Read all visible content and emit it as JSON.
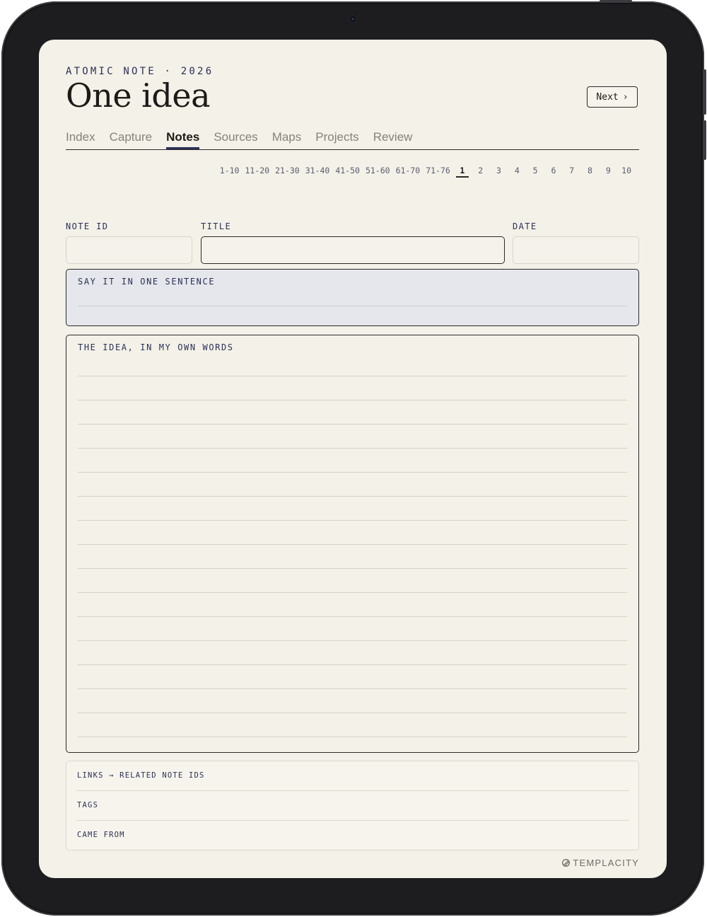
{
  "header": {
    "eyebrow": "ATOMIC NOTE · 2026",
    "title": "One idea",
    "next_label": "Next",
    "next_chevron": "›"
  },
  "tabs": [
    {
      "label": "Index",
      "active": false
    },
    {
      "label": "Capture",
      "active": false
    },
    {
      "label": "Notes",
      "active": true
    },
    {
      "label": "Sources",
      "active": false
    },
    {
      "label": "Maps",
      "active": false
    },
    {
      "label": "Projects",
      "active": false
    },
    {
      "label": "Review",
      "active": false
    }
  ],
  "pager": {
    "ranges": [
      "1-10",
      "11-20",
      "21-30",
      "31-40",
      "41-50",
      "51-60",
      "61-70",
      "71-76"
    ],
    "pages": [
      "1",
      "2",
      "3",
      "4",
      "5",
      "6",
      "7",
      "8",
      "9",
      "10"
    ],
    "active_page": "1"
  },
  "fields": {
    "note_id": {
      "label": "NOTE ID",
      "value": ""
    },
    "title": {
      "label": "TITLE",
      "value": ""
    },
    "date": {
      "label": "DATE",
      "value": ""
    }
  },
  "sentence": {
    "label": "SAY IT IN ONE SENTENCE",
    "value": ""
  },
  "idea": {
    "label": "THE IDEA, IN MY OWN WORDS",
    "value": ""
  },
  "links": [
    {
      "label": "LINKS → RELATED NOTE IDS",
      "value": ""
    },
    {
      "label": "TAGS",
      "value": ""
    },
    {
      "label": "CAME FROM",
      "value": ""
    }
  ],
  "brand": {
    "name": "TEMPLACITY",
    "icon": "templacity-logo-icon"
  },
  "colors": {
    "accent_navy": "#2c3157",
    "paper": "#f3f1e8",
    "sentence_fill": "#e5e7ec",
    "ink": "#1c1b18",
    "bezel": "#1d1d20"
  }
}
